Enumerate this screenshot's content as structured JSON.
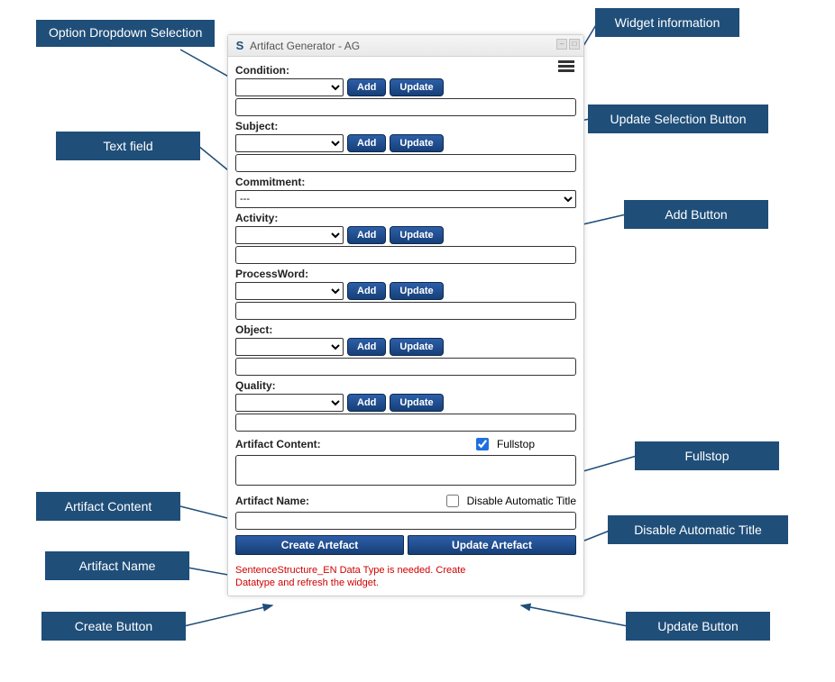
{
  "callouts": {
    "option_dropdown": "Option Dropdown Selection",
    "text_field": "Text field",
    "artifact_content": "Artifact Content",
    "artifact_name": "Artifact Name",
    "create_button": "Create Button",
    "widget_info": "Widget information",
    "update_selection": "Update Selection Button",
    "add_button": "Add Button",
    "fullstop": "Fullstop",
    "disable_auto_title": "Disable Automatic Title",
    "update_button": "Update Button"
  },
  "widget": {
    "logo_letter": "S",
    "title": "Artifact Generator - AG",
    "sections": {
      "condition": {
        "label": "Condition:",
        "add": "Add",
        "update": "Update",
        "text": ""
      },
      "subject": {
        "label": "Subject:",
        "add": "Add",
        "update": "Update",
        "text": ""
      },
      "commitment": {
        "label": "Commitment:",
        "selected": "---"
      },
      "activity": {
        "label": "Activity:",
        "add": "Add",
        "update": "Update",
        "text": ""
      },
      "processword": {
        "label": "ProcessWord:",
        "add": "Add",
        "update": "Update",
        "text": ""
      },
      "object": {
        "label": "Object:",
        "add": "Add",
        "update": "Update",
        "text": ""
      },
      "quality": {
        "label": "Quality:",
        "add": "Add",
        "update": "Update",
        "text": ""
      }
    },
    "artifact_content": {
      "label": "Artifact Content:",
      "fullstop_label": "Fullstop",
      "fullstop_checked": true,
      "text": ""
    },
    "artifact_name": {
      "label": "Artifact Name:",
      "disable_title_label": "Disable Automatic Title",
      "disable_title_checked": false,
      "text": ""
    },
    "buttons": {
      "create": "Create Artefact",
      "update": "Update Artefact"
    },
    "error": "SentenceStructure_EN Data Type is needed. Create Datatype and refresh the widget."
  }
}
